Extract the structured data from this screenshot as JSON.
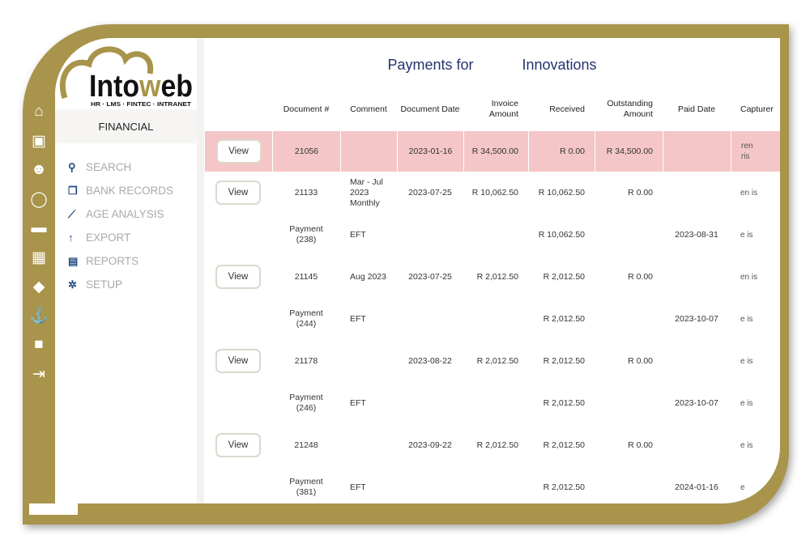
{
  "brand": {
    "name": "Intoweb",
    "tagline": "HR · LMS · FINTEC · INTRANET",
    "gold": "#a8944a",
    "navy": "#24336e",
    "highlight": "#f4c6c7"
  },
  "iconbar": [
    "home-icon",
    "briefcase-icon",
    "users-icon",
    "chat-icon",
    "folder-icon",
    "calendar-icon",
    "graduation-cap-icon",
    "anchor-icon",
    "lock-icon",
    "logout-icon"
  ],
  "sidebar": {
    "section": "FINANCIAL",
    "items": [
      {
        "label": "SEARCH",
        "icon": "search-icon"
      },
      {
        "label": "BANK RECORDS",
        "icon": "copy-icon"
      },
      {
        "label": "AGE ANALYSIS",
        "icon": "chart-icon"
      },
      {
        "label": "EXPORT",
        "icon": "arrow-up-icon"
      },
      {
        "label": "REPORTS",
        "icon": "file-icon"
      },
      {
        "label": "SETUP",
        "icon": "gear-icon"
      }
    ]
  },
  "main": {
    "title_prefix": "Payments for",
    "title_suffix": "Innovations",
    "columns": [
      "",
      "Document #",
      "Comment",
      "Document Date",
      "Invoice Amount",
      "Received",
      "Outstanding Amount",
      "Paid Date",
      "Capturer"
    ],
    "view_label": "View",
    "rows": [
      {
        "view": true,
        "highlight": true,
        "doc": "21056",
        "comment": "",
        "date": "2023-01-16",
        "invoice": "R 34,500.00",
        "received": "R 0.00",
        "outstanding": "R 34,500.00",
        "paid": "",
        "capturer": "ren ris"
      },
      {
        "view": true,
        "doc": "21133",
        "comment": "Mar - Jul 2023 Monthly",
        "date": "2023-07-25",
        "invoice": "R 10,062.50",
        "received": "R 10,062.50",
        "outstanding": "R 0.00",
        "paid": "",
        "capturer": "en is"
      },
      {
        "view": false,
        "doc": "Payment (238)",
        "comment": "EFT",
        "date": "",
        "invoice": "",
        "received": "R 10,062.50",
        "outstanding": "",
        "paid": "2023-08-31",
        "capturer": "e is"
      },
      {
        "view": true,
        "doc": "21145",
        "comment": "Aug 2023",
        "date": "2023-07-25",
        "invoice": "R 2,012.50",
        "received": "R 2,012.50",
        "outstanding": "R 0.00",
        "paid": "",
        "capturer": "en is"
      },
      {
        "view": false,
        "doc": "Payment (244)",
        "comment": "EFT",
        "date": "",
        "invoice": "",
        "received": "R 2,012.50",
        "outstanding": "",
        "paid": "2023-10-07",
        "capturer": "e is"
      },
      {
        "view": true,
        "doc": "21178",
        "comment": "",
        "date": "2023-08-22",
        "invoice": "R 2,012.50",
        "received": "R 2,012.50",
        "outstanding": "R 0.00",
        "paid": "",
        "capturer": "e is"
      },
      {
        "view": false,
        "doc": "Payment (246)",
        "comment": "EFT",
        "date": "",
        "invoice": "",
        "received": "R 2,012.50",
        "outstanding": "",
        "paid": "2023-10-07",
        "capturer": "e is"
      },
      {
        "view": true,
        "doc": "21248",
        "comment": "",
        "date": "2023-09-22",
        "invoice": "R 2,012.50",
        "received": "R 2,012.50",
        "outstanding": "R 0.00",
        "paid": "",
        "capturer": "e is"
      },
      {
        "view": false,
        "doc": "Payment (381)",
        "comment": "EFT",
        "date": "",
        "invoice": "",
        "received": "R 2,012.50",
        "outstanding": "",
        "paid": "2024-01-16",
        "capturer": "e"
      }
    ]
  }
}
